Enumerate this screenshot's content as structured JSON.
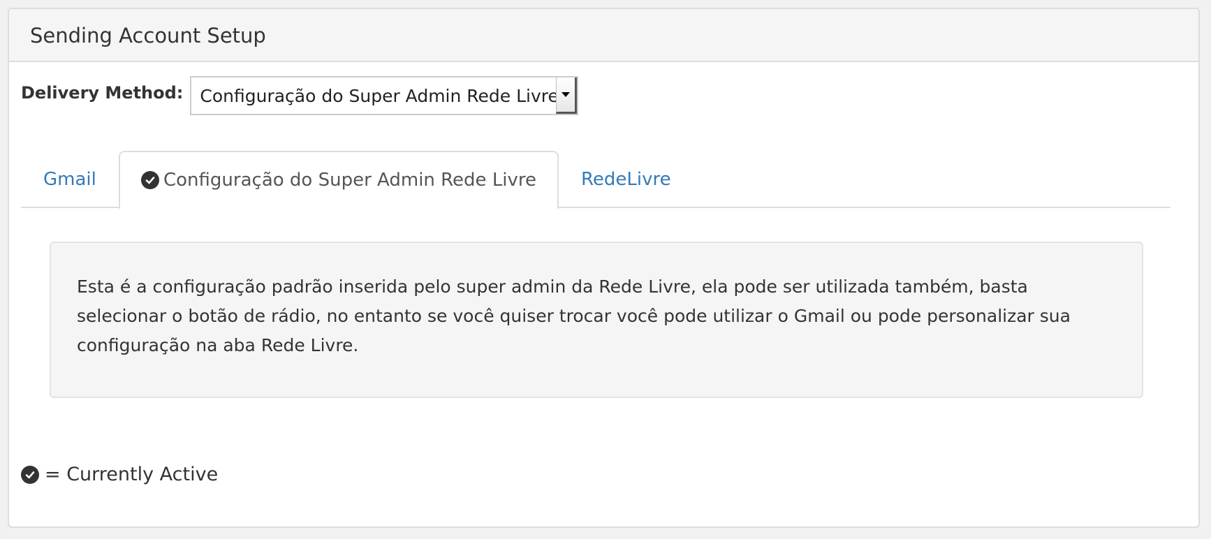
{
  "panel": {
    "title": "Sending Account Setup"
  },
  "delivery": {
    "label": "Delivery Method:",
    "selected": "Configuração do Super Admin Rede Livre",
    "arrow_icon": "caret-down-icon"
  },
  "tabs": [
    {
      "label": "Gmail",
      "active": false
    },
    {
      "label": "Configuração do Super Admin Rede Livre",
      "active": true,
      "icon": "check-circle-icon"
    },
    {
      "label": "RedeLivre",
      "active": false
    }
  ],
  "well": {
    "text": "Esta é a configuração padrão inserida pelo super admin da Rede Livre, ela pode ser utilizada também, basta selecionar o botão de rádio, no entanto se você quiser trocar você pode utilizar o Gmail ou pode personalizar sua configuração na aba Rede Livre."
  },
  "legend": {
    "icon": "check-circle-icon",
    "text": "= Currently Active"
  },
  "colors": {
    "link": "#337ab7",
    "active_tab_text": "#555555",
    "heading_bg": "#f5f5f5",
    "well_bg": "#f5f5f5",
    "border": "#dddddd",
    "icon": "#333333"
  }
}
